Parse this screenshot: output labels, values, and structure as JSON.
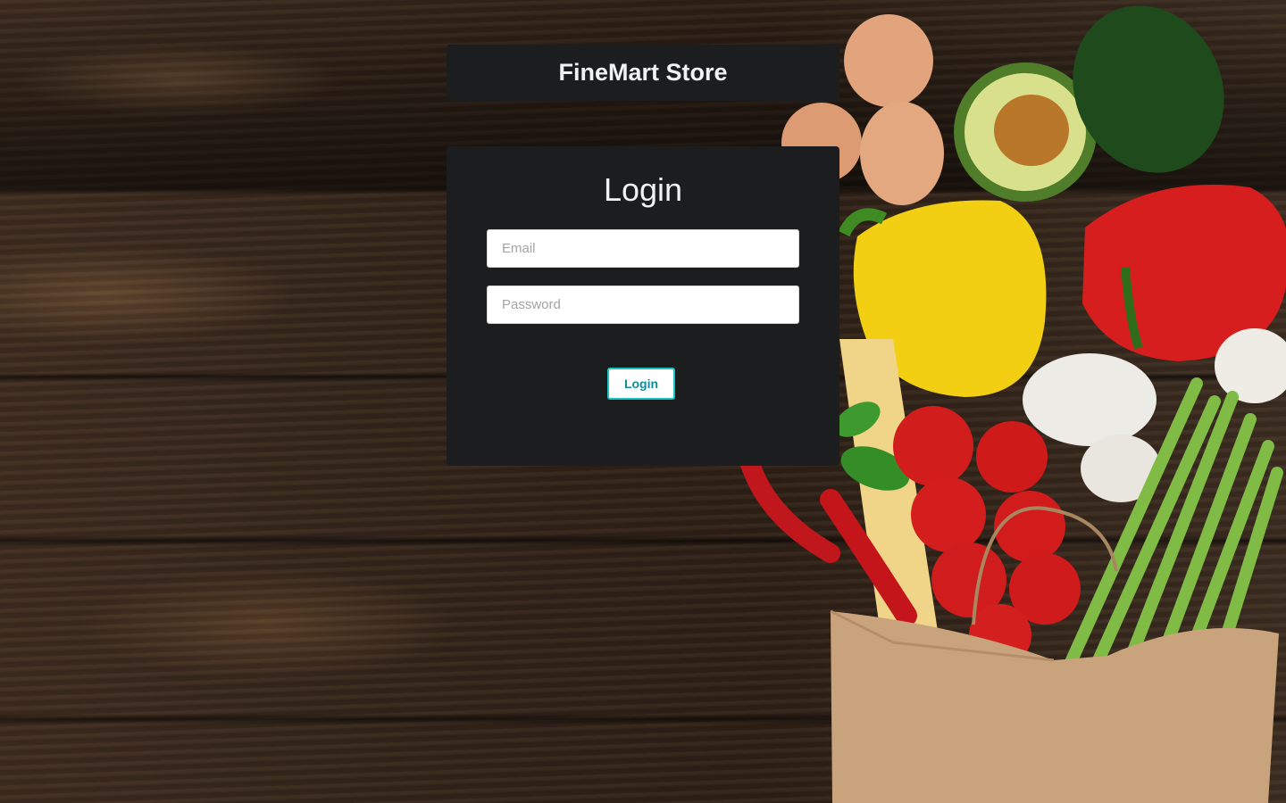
{
  "header": {
    "title": "FineMart Store"
  },
  "login": {
    "heading": "Login",
    "email": {
      "value": "",
      "placeholder": "Email"
    },
    "password": {
      "value": "",
      "placeholder": "Password"
    },
    "submit_label": "Login"
  },
  "colors": {
    "panel": "#1c1d1f",
    "accent": "#17c3c3",
    "button_text": "#0c8c9a"
  }
}
